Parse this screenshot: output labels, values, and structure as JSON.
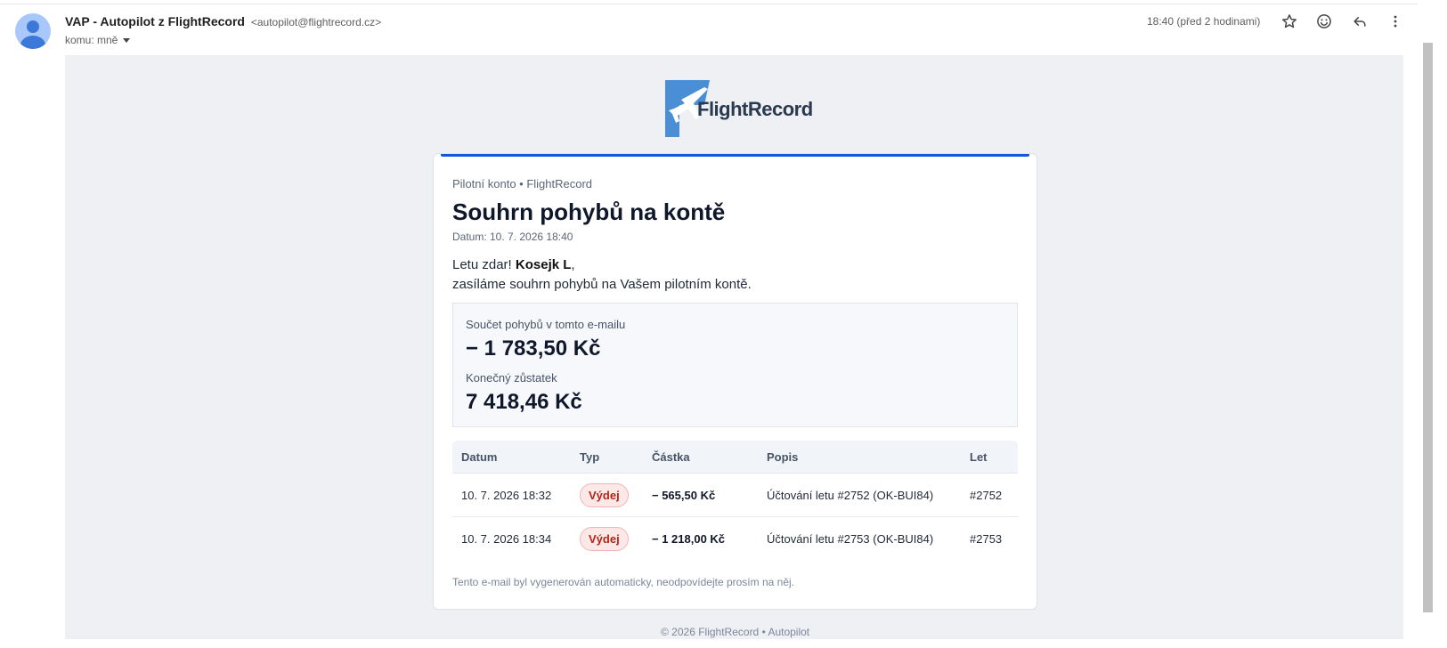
{
  "header": {
    "sender_name": "VAP - Autopilot z FlightRecord",
    "sender_email": "<autopilot@flightrecord.cz>",
    "to_label": "komu: mně",
    "time": "18:40 (před 2 hodinami)",
    "icons": [
      "star-icon",
      "emoji-icon",
      "reply-icon",
      "more-vert-icon"
    ]
  },
  "email": {
    "logo_text": "FlightRecord",
    "eyebrow": "Pilotní konto • FlightRecord",
    "title": "Souhrn pohybů na kontě",
    "date": "Datum: 10. 7. 2026 18:40",
    "greeting_prefix": "Letu zdar! ",
    "greeting_name": "Kosejk L",
    "greeting_suffix": ",",
    "greeting_line2": "zasíláme souhrn pohybů na Vašem pilotním kontě.",
    "summary": {
      "sum_label": "Součet pohybů v tomto e-mailu",
      "sum_value": "− 1 783,50 Kč",
      "balance_label": "Konečný zůstatek",
      "balance_value": "7 418,46 Kč"
    },
    "table": {
      "headers": [
        "Datum",
        "Typ",
        "Částka",
        "Popis",
        "Let"
      ],
      "rows": [
        {
          "date": "10. 7. 2026 18:32",
          "type": "Výdej",
          "amount": "− 565,50 Kč",
          "desc": "Účtování letu #2752 (OK-BUI84)",
          "flight": "#2752"
        },
        {
          "date": "10. 7. 2026 18:34",
          "type": "Výdej",
          "amount": "− 1 218,00 Kč",
          "desc": "Účtování letu #2753 (OK-BUI84)",
          "flight": "#2753"
        }
      ]
    },
    "footnote": "Tento e-mail byl vygenerován automaticky, neodpovídejte prosím na něj.",
    "copyright": "© 2026 FlightRecord • Autopilot"
  },
  "colors": {
    "accent": "#1a56db",
    "badge_bg": "#fde8e8",
    "badge_text": "#b42318",
    "logo_blue": "#4a8fd6"
  }
}
